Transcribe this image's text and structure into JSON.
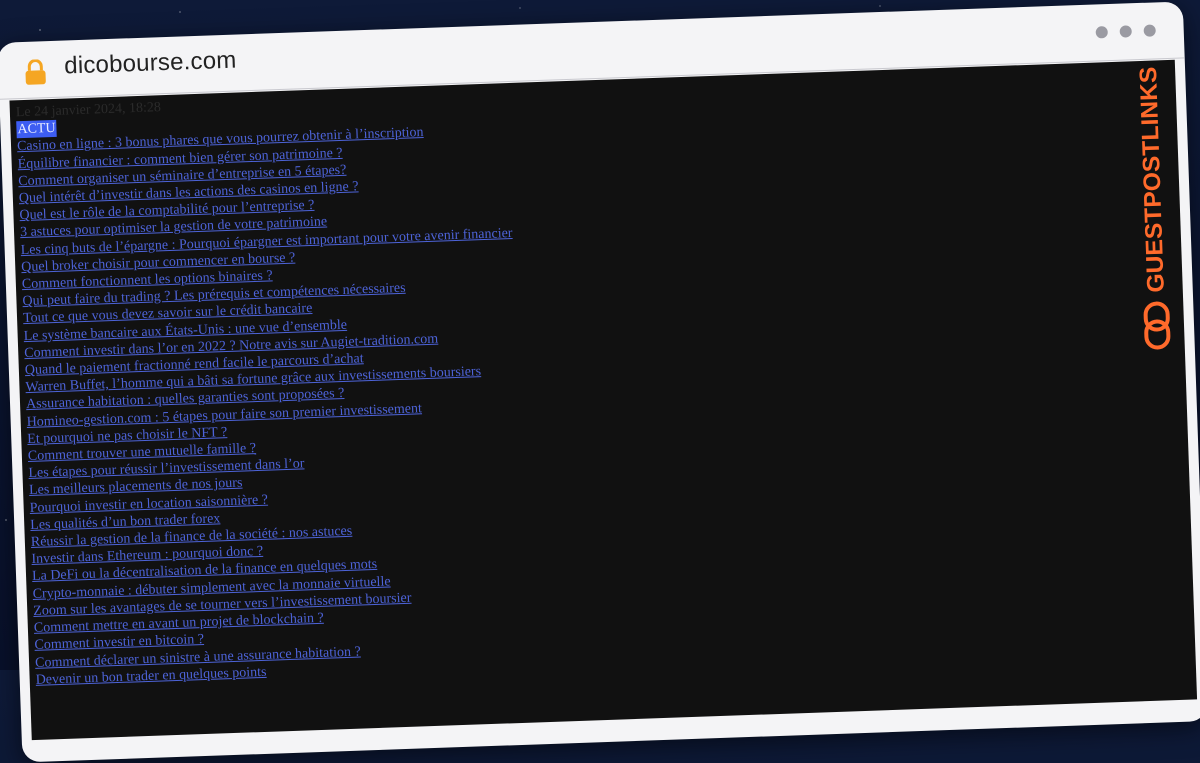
{
  "browser": {
    "url": "dicobourse.com",
    "lock_icon": "lock-icon",
    "window_controls": [
      "dot",
      "dot",
      "dot"
    ]
  },
  "page": {
    "date": "Le 24 janvier 2024, 18:28",
    "category_label": "ACTU",
    "links": [
      "Casino en ligne : 3 bonus phares que vous pourrez obtenir à l’inscription",
      "Équilibre financier : comment bien gérer son patrimoine ?",
      "Comment organiser un séminaire d’entreprise en 5 étapes?",
      "Quel intérêt d’investir dans les actions des casinos en ligne ?",
      "Quel est le rôle de la comptabilité pour l’entreprise ?",
      "3 astuces pour optimiser la gestion de votre patrimoine",
      "Les cinq buts de l’épargne : Pourquoi épargner est important pour votre avenir financier",
      "Quel broker choisir pour commencer en bourse ?",
      "Comment fonctionnent les options binaires ?",
      "Qui peut faire du trading ? Les prérequis et compétences nécessaires",
      "Tout ce que vous devez savoir sur le crédit bancaire",
      "Le système bancaire aux États-Unis : une vue d’ensemble",
      "Comment investir dans l’or en 2022 ? Notre avis sur Augiet-tradition.com",
      "Quand le paiement fractionné rend facile le parcours d’achat",
      "Warren Buffet, l’homme qui a bâti sa fortune grâce aux investissements boursiers",
      "Assurance habitation : quelles garanties sont proposées ?",
      "Homineo-gestion.com : 5 étapes pour faire son premier investissement",
      "Et pourquoi ne pas choisir le NFT ?",
      "Comment trouver une mutuelle famille ?",
      "Les étapes pour réussir l’investissement dans l’or",
      "Les meilleurs placements de nos jours",
      "Pourquoi investir en location saisonnière ?",
      "Les qualités d’un bon trader forex",
      "Réussir la gestion de la finance de la société : nos astuces",
      "Investir dans Ethereum : pourquoi donc ?",
      "La DeFi ou la décentralisation de la finance en quelques mots",
      "Crypto-monnaie : débuter simplement avec la monnaie virtuelle",
      "Zoom sur les avantages de se tourner vers l’investissement boursier",
      "Comment mettre en avant un projet de blockchain ?",
      "Comment investir en bitcoin ?",
      "Comment déclarer un sinistre à une assurance habitation ?",
      "Devenir un bon trader en quelques points"
    ]
  },
  "watermark": {
    "text": "GUESTPOSTLINKS",
    "icon": "chain-link-icon"
  },
  "colors": {
    "page_background": "#111111",
    "link": "#4d63d8",
    "highlight": "#3d5df2",
    "browser_chrome": "#f4f4f6",
    "watermark": "#ff6a2b"
  }
}
